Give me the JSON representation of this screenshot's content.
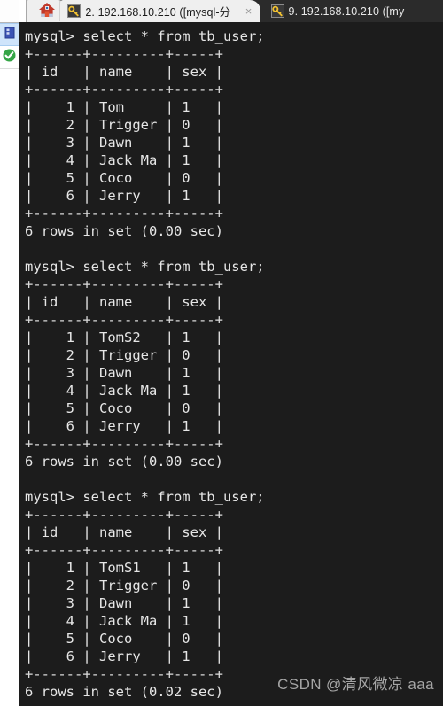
{
  "window": {
    "background_color": "#1c1c1c",
    "terminal_text_color": "#e6e6e6"
  },
  "tabbar": {
    "home_tab": {
      "icon": "home-icon",
      "label": ""
    },
    "tabs": [
      {
        "icon": "key-icon",
        "label": "2.  192.168.10.210  ([mysql-分",
        "close_label": "×",
        "active": true
      },
      {
        "icon": "key-icon",
        "label": "9.  192.168.10.210  ([my",
        "close_label": "×",
        "active": false
      }
    ]
  },
  "sidebar": {
    "items": [
      {
        "name": "session-manager-icon",
        "label": ""
      },
      {
        "name": "server-icon",
        "label": "",
        "selected": true
      },
      {
        "name": "connected-status-icon",
        "label": ""
      }
    ]
  },
  "terminal": {
    "blocks": [
      {
        "prompt": "mysql> select * from tb_user;",
        "top_rule": "+------+---------+-----+",
        "header": "| id   | name    | sex |",
        "mid_rule": "+------+---------+-----+",
        "rows": [
          "|    1 | Tom     | 1   |",
          "|    2 | Trigger | 0   |",
          "|    3 | Dawn    | 1   |",
          "|    4 | Jack Ma | 1   |",
          "|    5 | Coco    | 0   |",
          "|    6 | Jerry   | 1   |"
        ],
        "bottom_rule": "+------+---------+-----+",
        "status": "6 rows in set (0.00 sec)"
      },
      {
        "prompt": "mysql> select * from tb_user;",
        "top_rule": "+------+---------+-----+",
        "header": "| id   | name    | sex |",
        "mid_rule": "+------+---------+-----+",
        "rows": [
          "|    1 | TomS2   | 1   |",
          "|    2 | Trigger | 0   |",
          "|    3 | Dawn    | 1   |",
          "|    4 | Jack Ma | 1   |",
          "|    5 | Coco    | 0   |",
          "|    6 | Jerry   | 1   |"
        ],
        "bottom_rule": "+------+---------+-----+",
        "status": "6 rows in set (0.00 sec)"
      },
      {
        "prompt": "mysql> select * from tb_user;",
        "top_rule": "+------+---------+-----+",
        "header": "| id   | name    | sex |",
        "mid_rule": "+------+---------+-----+",
        "rows": [
          "|    1 | TomS1   | 1   |",
          "|    2 | Trigger | 0   |",
          "|    3 | Dawn    | 1   |",
          "|    4 | Jack Ma | 1   |",
          "|    5 | Coco    | 0   |",
          "|    6 | Jerry   | 1   |"
        ],
        "bottom_rule": "+------+---------+-----+",
        "status": "6 rows in set (0.02 sec)"
      }
    ]
  },
  "watermark": {
    "text": "CSDN @清风微凉 aaa"
  }
}
